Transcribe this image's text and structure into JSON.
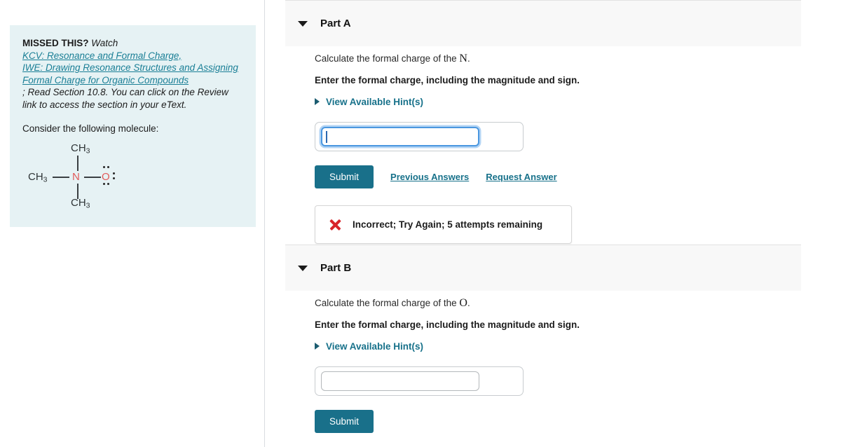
{
  "sidebar": {
    "missed_label": "MISSED THIS?",
    "watch_word": "Watch",
    "links": [
      "KCV: Resonance and Formal Charge,",
      "IWE: Drawing Resonance Structures and Assigning",
      "Formal Charge for Organic Compounds"
    ],
    "tail_text": "; Read Section 10.8. You can click on the Review link to access the section in your eText.",
    "consider_text": "Consider the following molecule:",
    "molecule": {
      "name": "trimethylamine-N-oxide",
      "top_group": "CH3",
      "left_group": "CH3",
      "bottom_group": "CH3",
      "center_atom": "N",
      "terminal_atom": "O",
      "nitrogen_color": "#e15a5a",
      "oxygen_color": "#e15a5a",
      "lone_pairs": 3
    }
  },
  "parts": [
    {
      "title": "Part A",
      "caret_icon": "caret-down-icon",
      "question_prefix": "Calculate the formal charge of the ",
      "question_variable": "N",
      "question_suffix": ".",
      "instruction": "Enter the formal charge, including the magnitude and sign.",
      "hint_label": "View Available Hint(s)",
      "hint_icon": "caret-right-icon",
      "input_value": "",
      "input_placeholder": "",
      "input_focused": true,
      "submit_label": "Submit",
      "links": [
        "Previous Answers",
        "Request Answer"
      ],
      "feedback": {
        "icon": "x-mark-icon",
        "text": "Incorrect; Try Again; 5 attempts remaining",
        "color": "#d8232a"
      }
    },
    {
      "title": "Part B",
      "caret_icon": "caret-down-icon",
      "question_prefix": "Calculate the formal charge of the ",
      "question_variable": "O",
      "question_suffix": ".",
      "instruction": "Enter the formal charge, including the magnitude and sign.",
      "hint_label": "View Available Hint(s)",
      "hint_icon": "caret-right-icon",
      "input_value": "",
      "input_placeholder": "",
      "input_focused": false,
      "submit_label": "Submit",
      "links": [],
      "feedback": null
    }
  ],
  "colors": {
    "accent_teal": "#17718a",
    "submit_bg": "#19708a",
    "panel_bg": "#e6f2f4",
    "header_bg": "#f8f8f8",
    "error_red": "#d8232a",
    "focus_blue": "#4a97e0"
  }
}
